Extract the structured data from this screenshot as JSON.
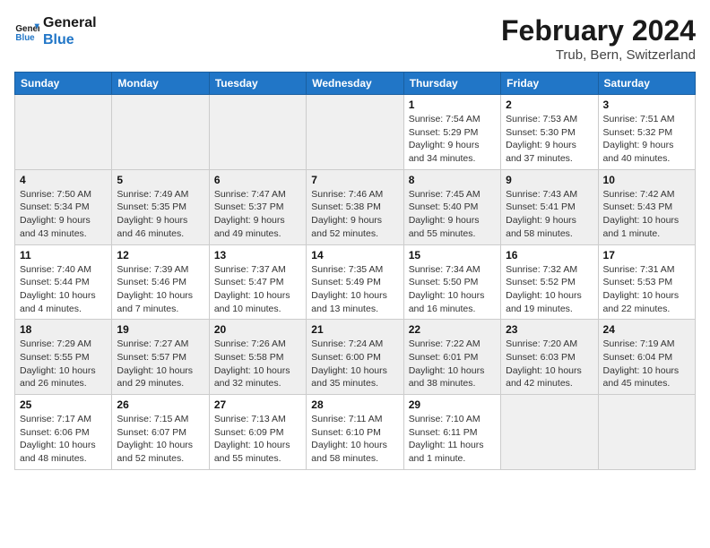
{
  "header": {
    "logo_text_general": "General",
    "logo_text_blue": "Blue",
    "title": "February 2024",
    "subtitle": "Trub, Bern, Switzerland"
  },
  "weekdays": [
    "Sunday",
    "Monday",
    "Tuesday",
    "Wednesday",
    "Thursday",
    "Friday",
    "Saturday"
  ],
  "weeks": [
    [
      {
        "day": "",
        "info": ""
      },
      {
        "day": "",
        "info": ""
      },
      {
        "day": "",
        "info": ""
      },
      {
        "day": "",
        "info": ""
      },
      {
        "day": "1",
        "info": "Sunrise: 7:54 AM\nSunset: 5:29 PM\nDaylight: 9 hours and 34 minutes."
      },
      {
        "day": "2",
        "info": "Sunrise: 7:53 AM\nSunset: 5:30 PM\nDaylight: 9 hours and 37 minutes."
      },
      {
        "day": "3",
        "info": "Sunrise: 7:51 AM\nSunset: 5:32 PM\nDaylight: 9 hours and 40 minutes."
      }
    ],
    [
      {
        "day": "4",
        "info": "Sunrise: 7:50 AM\nSunset: 5:34 PM\nDaylight: 9 hours and 43 minutes."
      },
      {
        "day": "5",
        "info": "Sunrise: 7:49 AM\nSunset: 5:35 PM\nDaylight: 9 hours and 46 minutes."
      },
      {
        "day": "6",
        "info": "Sunrise: 7:47 AM\nSunset: 5:37 PM\nDaylight: 9 hours and 49 minutes."
      },
      {
        "day": "7",
        "info": "Sunrise: 7:46 AM\nSunset: 5:38 PM\nDaylight: 9 hours and 52 minutes."
      },
      {
        "day": "8",
        "info": "Sunrise: 7:45 AM\nSunset: 5:40 PM\nDaylight: 9 hours and 55 minutes."
      },
      {
        "day": "9",
        "info": "Sunrise: 7:43 AM\nSunset: 5:41 PM\nDaylight: 9 hours and 58 minutes."
      },
      {
        "day": "10",
        "info": "Sunrise: 7:42 AM\nSunset: 5:43 PM\nDaylight: 10 hours and 1 minute."
      }
    ],
    [
      {
        "day": "11",
        "info": "Sunrise: 7:40 AM\nSunset: 5:44 PM\nDaylight: 10 hours and 4 minutes."
      },
      {
        "day": "12",
        "info": "Sunrise: 7:39 AM\nSunset: 5:46 PM\nDaylight: 10 hours and 7 minutes."
      },
      {
        "day": "13",
        "info": "Sunrise: 7:37 AM\nSunset: 5:47 PM\nDaylight: 10 hours and 10 minutes."
      },
      {
        "day": "14",
        "info": "Sunrise: 7:35 AM\nSunset: 5:49 PM\nDaylight: 10 hours and 13 minutes."
      },
      {
        "day": "15",
        "info": "Sunrise: 7:34 AM\nSunset: 5:50 PM\nDaylight: 10 hours and 16 minutes."
      },
      {
        "day": "16",
        "info": "Sunrise: 7:32 AM\nSunset: 5:52 PM\nDaylight: 10 hours and 19 minutes."
      },
      {
        "day": "17",
        "info": "Sunrise: 7:31 AM\nSunset: 5:53 PM\nDaylight: 10 hours and 22 minutes."
      }
    ],
    [
      {
        "day": "18",
        "info": "Sunrise: 7:29 AM\nSunset: 5:55 PM\nDaylight: 10 hours and 26 minutes."
      },
      {
        "day": "19",
        "info": "Sunrise: 7:27 AM\nSunset: 5:57 PM\nDaylight: 10 hours and 29 minutes."
      },
      {
        "day": "20",
        "info": "Sunrise: 7:26 AM\nSunset: 5:58 PM\nDaylight: 10 hours and 32 minutes."
      },
      {
        "day": "21",
        "info": "Sunrise: 7:24 AM\nSunset: 6:00 PM\nDaylight: 10 hours and 35 minutes."
      },
      {
        "day": "22",
        "info": "Sunrise: 7:22 AM\nSunset: 6:01 PM\nDaylight: 10 hours and 38 minutes."
      },
      {
        "day": "23",
        "info": "Sunrise: 7:20 AM\nSunset: 6:03 PM\nDaylight: 10 hours and 42 minutes."
      },
      {
        "day": "24",
        "info": "Sunrise: 7:19 AM\nSunset: 6:04 PM\nDaylight: 10 hours and 45 minutes."
      }
    ],
    [
      {
        "day": "25",
        "info": "Sunrise: 7:17 AM\nSunset: 6:06 PM\nDaylight: 10 hours and 48 minutes."
      },
      {
        "day": "26",
        "info": "Sunrise: 7:15 AM\nSunset: 6:07 PM\nDaylight: 10 hours and 52 minutes."
      },
      {
        "day": "27",
        "info": "Sunrise: 7:13 AM\nSunset: 6:09 PM\nDaylight: 10 hours and 55 minutes."
      },
      {
        "day": "28",
        "info": "Sunrise: 7:11 AM\nSunset: 6:10 PM\nDaylight: 10 hours and 58 minutes."
      },
      {
        "day": "29",
        "info": "Sunrise: 7:10 AM\nSunset: 6:11 PM\nDaylight: 11 hours and 1 minute."
      },
      {
        "day": "",
        "info": ""
      },
      {
        "day": "",
        "info": ""
      }
    ]
  ]
}
